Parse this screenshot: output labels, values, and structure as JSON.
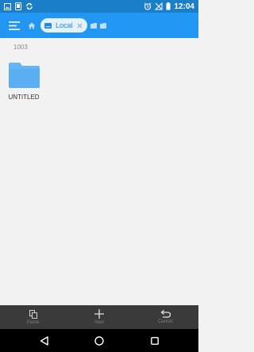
{
  "status_bar": {
    "time": "12:04",
    "left_icons": [
      "image-icon",
      "screenshot-icon",
      "sync-icon"
    ],
    "right_icons": [
      "alarm-icon",
      "no-signal-icon",
      "battery-icon"
    ]
  },
  "app_bar": {
    "color": "#2196f3",
    "menu_icon": "menu-icon",
    "home_icon": "home-icon",
    "chip": {
      "label": "Local",
      "icon": "storage-icon",
      "close_icon": "close-icon"
    },
    "crumb_icons": [
      "folder-crumb-icon",
      "folder-crumb-icon"
    ]
  },
  "content": {
    "path": "1003",
    "items": [
      {
        "name": "UNTITLED",
        "icon": "folder-icon",
        "color": "#64b5f6"
      }
    ]
  },
  "actions": [
    {
      "label": "Paste",
      "icon": "paste-icon"
    },
    {
      "label": "New",
      "icon": "plus-icon"
    },
    {
      "label": "Cancel",
      "icon": "undo-icon"
    }
  ],
  "nav": [
    "back-icon",
    "home-circle-icon",
    "recents-icon"
  ]
}
